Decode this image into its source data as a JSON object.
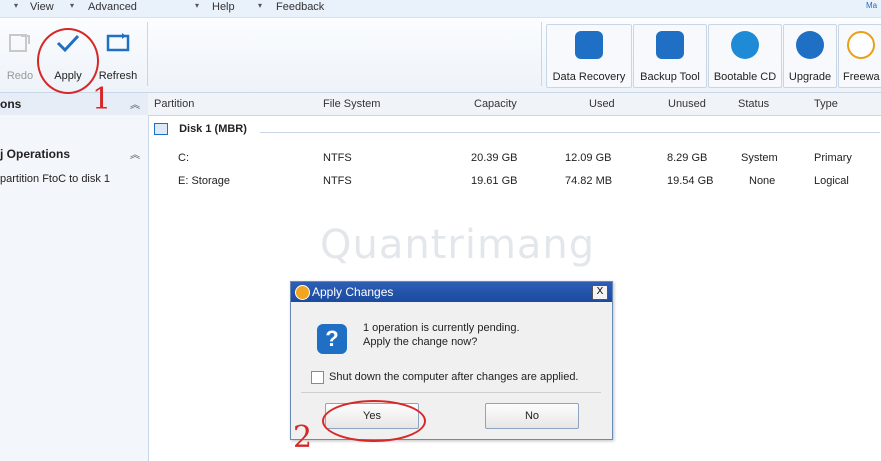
{
  "menubar": {
    "items": [
      "View",
      "Advanced",
      "Help",
      "Feedback"
    ],
    "right_logo": "Ma"
  },
  "toolbar": {
    "redo_label": "Redo",
    "apply_label": "Apply",
    "refresh_label": "Refresh",
    "ribbon": [
      {
        "label": "Data Recovery",
        "icon": "data-recovery-icon",
        "color": "#1f6fc4"
      },
      {
        "label": "Backup Tool",
        "icon": "backup-tool-icon",
        "color": "#1f6fc4"
      },
      {
        "label": "Bootable CD",
        "icon": "bootable-cd-icon",
        "color": "#1f8ad6"
      },
      {
        "label": "Upgrade",
        "icon": "upgrade-icon",
        "color": "#1f6fc4"
      },
      {
        "label": "Freewa",
        "icon": "freeware-icon",
        "color": "#e8a019"
      }
    ]
  },
  "sidebar": {
    "section1_title": "ons",
    "section2_title": "j Operations",
    "pending_item": "partition  FtoC to disk 1"
  },
  "table": {
    "headers": [
      "Partition",
      "File System",
      "Capacity",
      "Used",
      "Unused",
      "Status",
      "Type"
    ],
    "disk_label": "Disk 1 (MBR)",
    "rows": [
      {
        "partition": "C:",
        "fs": "NTFS",
        "capacity": "20.39 GB",
        "used": "12.09 GB",
        "unused": "8.29 GB",
        "status": "System",
        "type": "Primary"
      },
      {
        "partition": "E: Storage",
        "fs": "NTFS",
        "capacity": "19.61 GB",
        "used": "74.82 MB",
        "unused": "19.54 GB",
        "status": "None",
        "type": "Logical"
      }
    ]
  },
  "watermark": "Quantrimang",
  "dialog": {
    "title": "Apply Changes",
    "close": "X",
    "message_line1": "1 operation is currently pending.",
    "message_line2": "Apply the change now?",
    "checkbox_label": "Shut down the computer after changes are applied.",
    "yes_label": "Yes",
    "no_label": "No"
  },
  "annotations": {
    "step1": "1",
    "step2": "2"
  },
  "colors": {
    "accent": "#1f6fc4",
    "annotation_red": "#d62828",
    "dialog_title": "#1b4aa0"
  }
}
